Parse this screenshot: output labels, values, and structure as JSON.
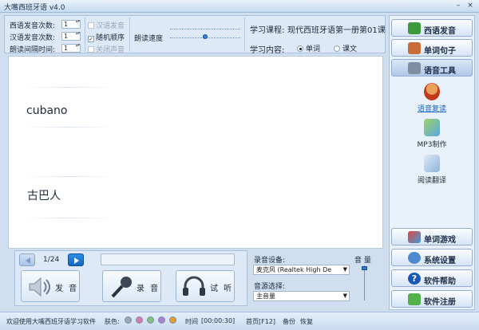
{
  "title": "大嘴西班牙语 v4.0",
  "window": {
    "minimize": "–",
    "close": "×"
  },
  "settings": {
    "es_count_label": "西语发音次数:",
    "es_count": "1",
    "cn_count_label": "汉语发音次数:",
    "cn_count": "1",
    "interval_label": "朗读间隔时间:",
    "interval": "1",
    "opt_cn": "汉语发音",
    "opt_random": "随机顺序",
    "opt_mute": "关闭声音",
    "speed_label": "朗读速度",
    "speed_level": 0.5
  },
  "course": {
    "label": "学习课程:",
    "name": "现代西班牙语第一册第01课",
    "content_label": "学习内容:",
    "opt_word": "单词",
    "opt_text": "课文"
  },
  "word": {
    "spanish": "cubano",
    "chinese": "古巴人"
  },
  "player": {
    "counter": "1/24",
    "speak": "发 音",
    "record": "录 音",
    "listen": "试 听"
  },
  "audio": {
    "device_label": "录音设备:",
    "device": "麦克风 (Realtek High De",
    "source_label": "音源选择:",
    "source": "主音量",
    "volume_label": "音 量"
  },
  "sidebar": {
    "top": [
      "西语发音",
      "单词句子",
      "语音工具"
    ],
    "tools": [
      "语音复读",
      "MP3制作",
      "阅读翻译"
    ],
    "bottom": [
      "单词游戏",
      "系统设置",
      "软件帮助",
      "软件注册"
    ]
  },
  "status": {
    "welcome": "欢迎使用大嘴西班牙语学习软件",
    "skin_label": "肤色:",
    "skin_colors": [
      "#9aa6b4",
      "#d87ba8",
      "#7fc27a",
      "#a97fd6",
      "#e59a2c"
    ],
    "time_label": "时间",
    "time": "[00:00:30]",
    "home": "首页[F12]",
    "backup": "备份",
    "restore": "恢复"
  },
  "colors": {
    "accent": "#1a66c2",
    "link": "#1a66c2"
  }
}
